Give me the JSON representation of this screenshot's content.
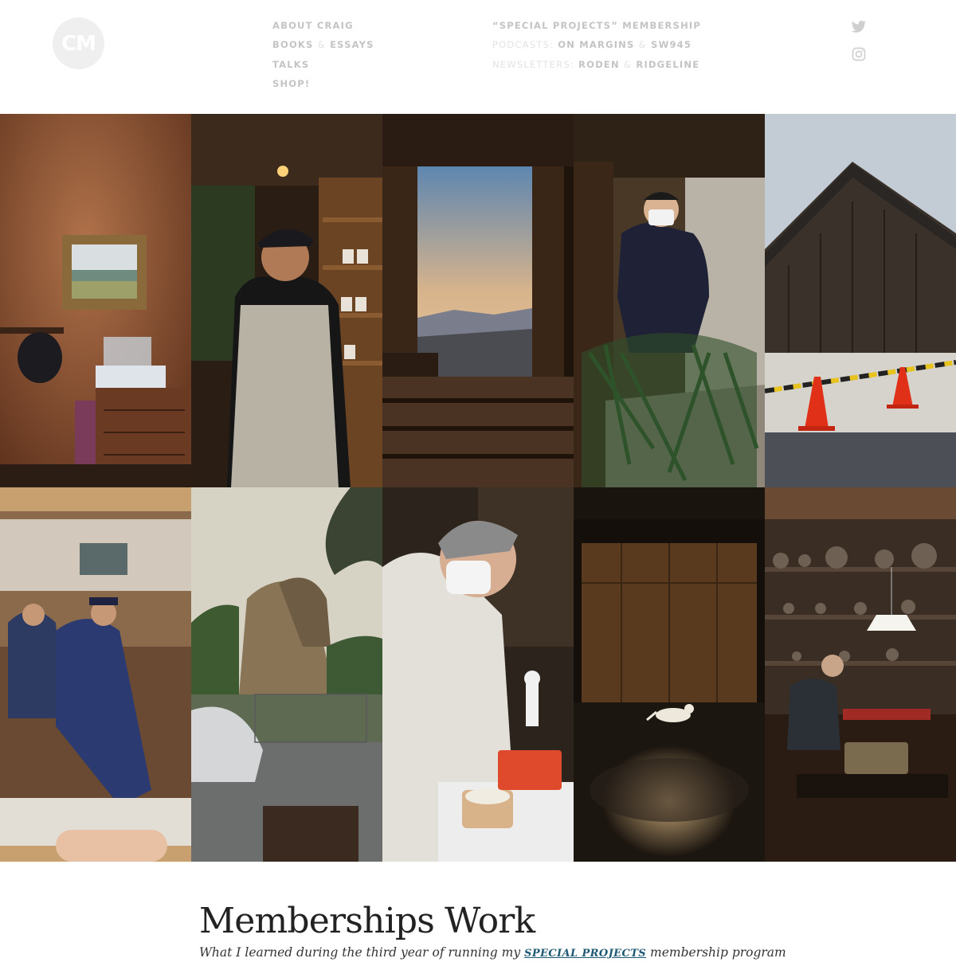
{
  "logo": {
    "text": "CM"
  },
  "nav": {
    "col1": [
      {
        "label": "ABOUT CRAIG"
      },
      {
        "label_a": "BOOKS",
        "sep": "&",
        "label_b": "ESSAYS"
      },
      {
        "label": "TALKS"
      },
      {
        "label": "SHOP!"
      }
    ],
    "col2": {
      "membership": "“SPECIAL PROJECTS” MEMBERSHIP",
      "podcasts_prefix": "PODCASTS:",
      "podcast_a": "ON MARGINS",
      "podcasts_sep": "&",
      "podcast_b": "SW945",
      "newsletters_prefix": "NEWSLETTERS:",
      "newsletter_a": "RODEN",
      "newsletters_sep": "&",
      "newsletter_b": "RIDGELINE"
    }
  },
  "social": [
    {
      "icon": "twitter-icon"
    },
    {
      "icon": "instagram-icon"
    }
  ],
  "photos": [
    {
      "name": "photo-room-with-painting"
    },
    {
      "name": "photo-potter-in-apron"
    },
    {
      "name": "photo-mountain-view-pavilion"
    },
    {
      "name": "photo-man-carrying-pine-branches"
    },
    {
      "name": "photo-wooden-barn-with-cones"
    },
    {
      "name": "photo-book-spread-cafe-men"
    },
    {
      "name": "photo-rock-formation"
    },
    {
      "name": "photo-man-preparing-toast"
    },
    {
      "name": "photo-cat-in-light"
    },
    {
      "name": "photo-man-at-desk-pottery-shelves"
    }
  ],
  "article": {
    "title": "Memberships Work",
    "subtitle_before": "What I learned during the third year of running my",
    "subtitle_link": "SPECIAL PROJECTS",
    "subtitle_after": "membership program"
  },
  "colors": {
    "nav_text": "#c4c4c4",
    "nav_separator": "#e3e3e3",
    "link": "#1e5a74",
    "title": "#222222"
  }
}
